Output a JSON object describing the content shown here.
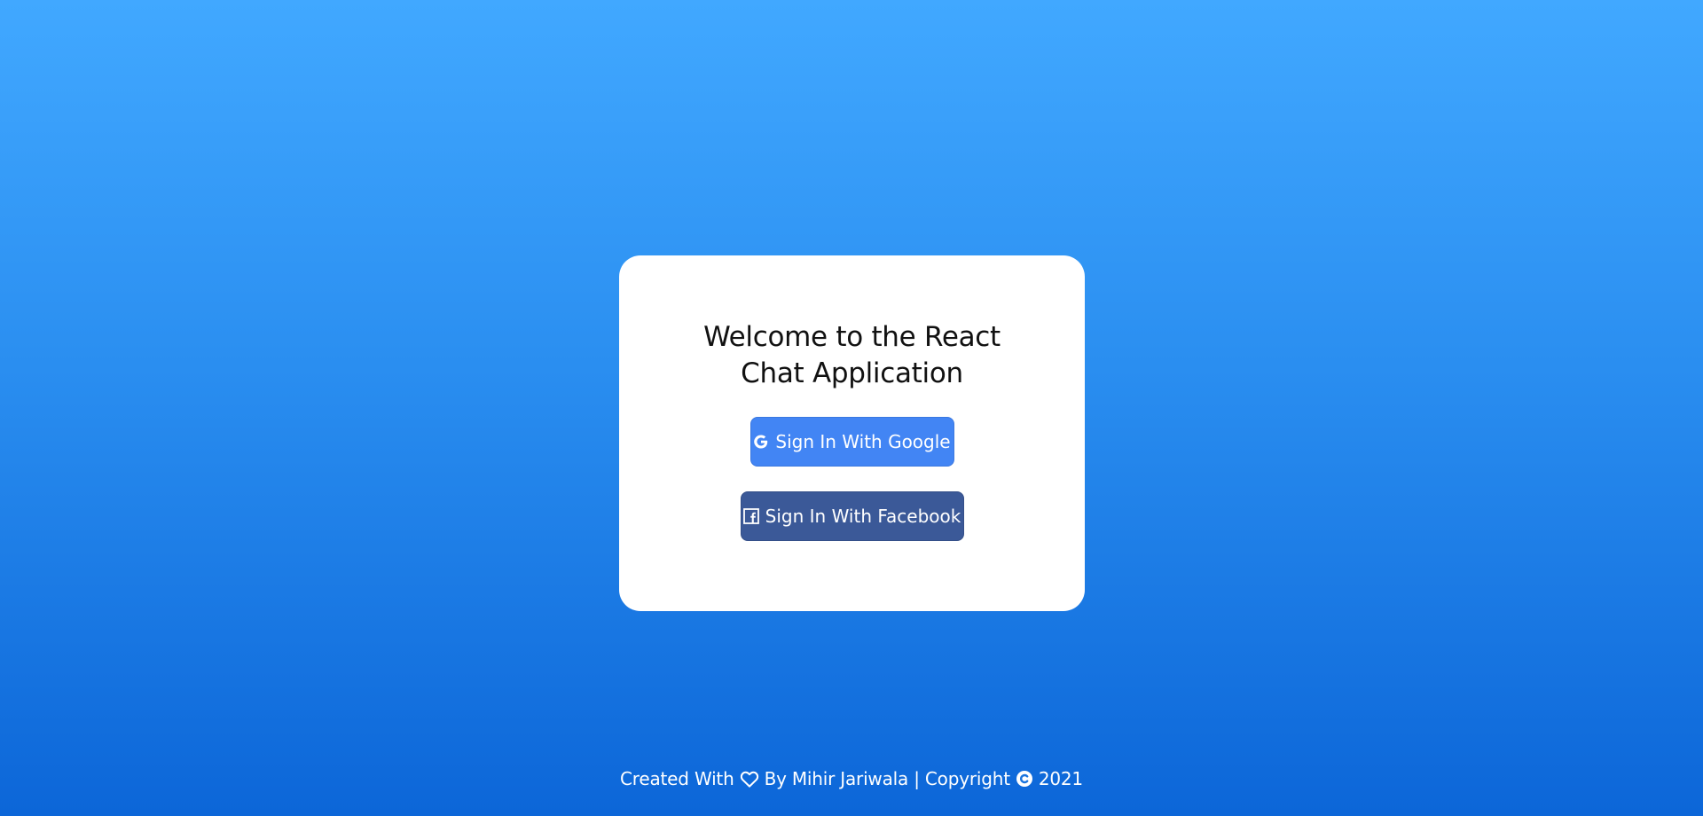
{
  "login": {
    "title": "Welcome to the React Chat Application",
    "google_button": {
      "label": "Sign In With Google",
      "icon": "google-icon",
      "color": "#4285f4"
    },
    "facebook_button": {
      "label": "Sign In With Facebook",
      "icon": "facebook-icon",
      "color": "#3b5998"
    }
  },
  "footer": {
    "created_with": "Created With",
    "heart_icon": "heart-icon",
    "by_text": "By Mihir Jariwala | Copyright",
    "copyright_icon": "copyright-icon",
    "year": "2021"
  },
  "colors": {
    "background_top": "#41a8ff",
    "background_bottom": "#0c66d8",
    "card": "#ffffff"
  }
}
